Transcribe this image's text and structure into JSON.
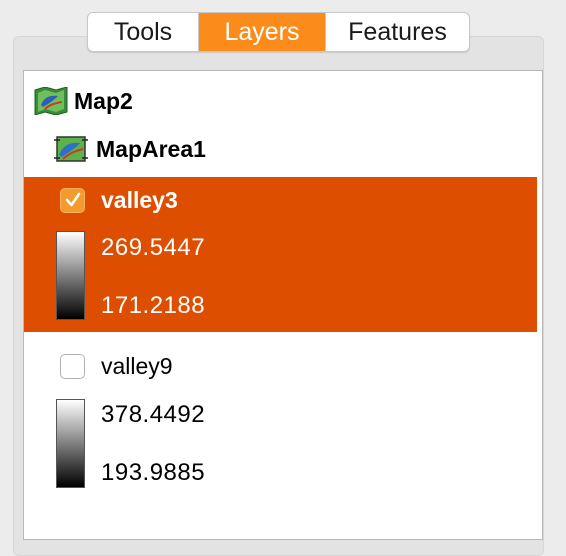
{
  "tabs": [
    {
      "label": "Tools",
      "active": false
    },
    {
      "label": "Layers",
      "active": true
    },
    {
      "label": "Features",
      "active": false
    }
  ],
  "tree": {
    "map": {
      "label": "Map2",
      "icon": "map-icon"
    },
    "map_area": {
      "label": "MapArea1",
      "icon": "map-area-icon"
    },
    "layers": [
      {
        "label": "valley3",
        "checked": true,
        "selected": true,
        "max": "269.5447",
        "min": "171.2188"
      },
      {
        "label": "valley9",
        "checked": false,
        "selected": false,
        "max": "378.4492",
        "min": "193.9885"
      }
    ]
  },
  "colors": {
    "active_tab": "#fb8c1c",
    "selection": "#de4e00",
    "checkbox_checked": "#f59a2d"
  }
}
